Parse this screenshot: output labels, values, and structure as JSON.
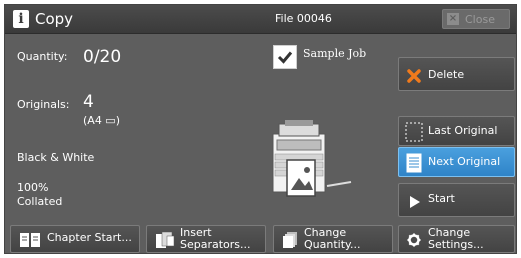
{
  "title": {
    "app_icon_glyph": "i",
    "app_title": "Copy",
    "file_label": "File 00046",
    "close_label": "Close",
    "close_glyph": "×"
  },
  "status": {
    "quantity_label": "Quantity:",
    "quantity_value": "0/20",
    "originals_label": "Originals:",
    "originals_value": "4",
    "originals_size": "(A4 ▭)",
    "color_mode": "Black & White",
    "zoom": "100%",
    "finishing": "Collated"
  },
  "sample_job": {
    "label": "Sample Job",
    "checked": true
  },
  "actions": {
    "delete_label": "Delete",
    "last_original_label": "Last Original",
    "next_original_label": "Next Original",
    "start_label": "Start"
  },
  "bottom": {
    "chapter_start_label": "Chapter Start...",
    "insert_separators_line1": "Insert",
    "insert_separators_line2": "Separators...",
    "change_quantity_line1": "Change",
    "change_quantity_line2": "Quantity...",
    "change_settings_line1": "Change",
    "change_settings_line2": "Settings..."
  },
  "colors": {
    "panel": "#5e5e5e",
    "titlebar": "#3a3a3a",
    "active_blue": "#3b8fd2",
    "delete_orange": "#f07a1c"
  },
  "icons": [
    "info-icon",
    "close-icon",
    "check-icon",
    "delete-x-icon",
    "last-original-icon",
    "next-original-icon",
    "start-play-icon",
    "copier-icon",
    "chapter-start-icon",
    "insert-separators-icon",
    "change-quantity-icon",
    "gear-icon"
  ]
}
